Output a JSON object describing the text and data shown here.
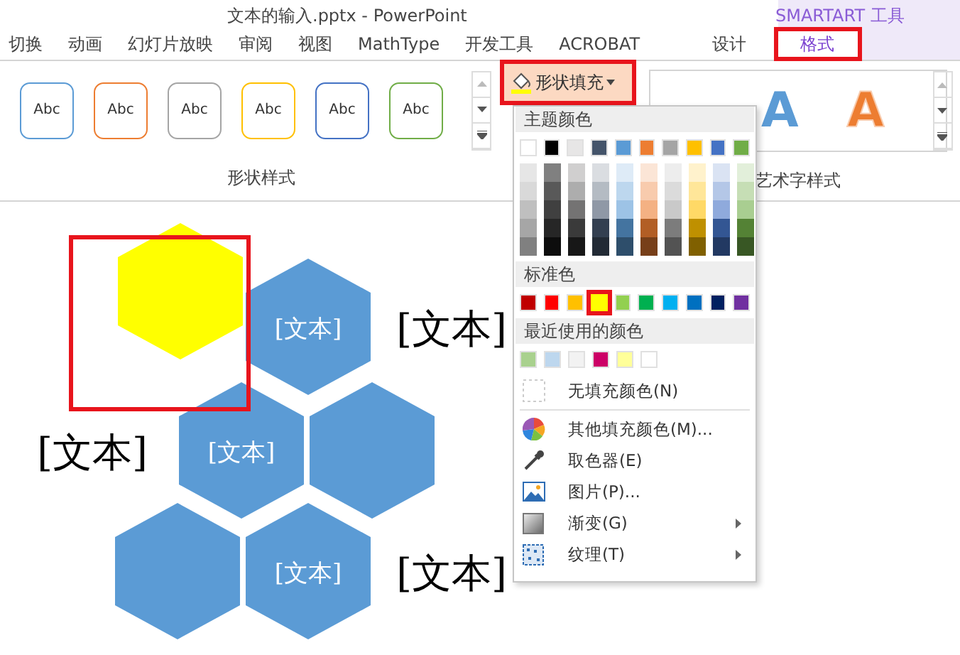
{
  "window": {
    "title": "文本的输入.pptx - PowerPoint",
    "context_label": "SMARTART 工具"
  },
  "tabs": [
    {
      "label": "切换",
      "selected": false,
      "contextual": false
    },
    {
      "label": "动画",
      "selected": false,
      "contextual": false
    },
    {
      "label": "幻灯片放映",
      "selected": false,
      "contextual": false
    },
    {
      "label": "审阅",
      "selected": false,
      "contextual": false
    },
    {
      "label": "视图",
      "selected": false,
      "contextual": false
    },
    {
      "label": "MathType",
      "selected": false,
      "contextual": false
    },
    {
      "label": "开发工具",
      "selected": false,
      "contextual": false
    },
    {
      "label": "ACROBAT",
      "selected": false,
      "contextual": false
    },
    {
      "label": "设计",
      "selected": false,
      "contextual": true
    },
    {
      "label": "格式",
      "selected": true,
      "contextual": true
    }
  ],
  "shape_styles": {
    "label": "形状样式",
    "items": [
      {
        "text": "Abc",
        "color": "#5b9bd5"
      },
      {
        "text": "Abc",
        "color": "#ed7d31"
      },
      {
        "text": "Abc",
        "color": "#a5a5a5"
      },
      {
        "text": "Abc",
        "color": "#ffc000"
      },
      {
        "text": "Abc",
        "color": "#4472c4"
      },
      {
        "text": "Abc",
        "color": "#70ad47"
      }
    ]
  },
  "wordart_styles": {
    "label": "艺术字样式",
    "items": [
      {
        "text": "A",
        "color": "#5b9bd5"
      },
      {
        "text": "A",
        "color": "#ed7d31"
      }
    ]
  },
  "shape_fill_button": {
    "label": "形状填充",
    "open": true
  },
  "fill_menu": {
    "theme_header": "主题颜色",
    "theme_colors": [
      {
        "color": "#ffffff"
      },
      {
        "color": "#000000"
      },
      {
        "color": "#e7e6e6"
      },
      {
        "color": "#44546a"
      },
      {
        "color": "#5b9bd5"
      },
      {
        "color": "#ed7d31"
      },
      {
        "color": "#a5a5a5"
      },
      {
        "color": "#ffc000"
      },
      {
        "color": "#4472c4"
      },
      {
        "color": "#70ad47"
      }
    ],
    "standard_header": "标准色",
    "standard_colors": [
      {
        "color": "#c00000",
        "selected": false
      },
      {
        "color": "#ff0000",
        "selected": false
      },
      {
        "color": "#ffc000",
        "selected": false
      },
      {
        "color": "#ffff00",
        "selected": true
      },
      {
        "color": "#92d050",
        "selected": false
      },
      {
        "color": "#00b050",
        "selected": false
      },
      {
        "color": "#00b0f0",
        "selected": false
      },
      {
        "color": "#0070c0",
        "selected": false
      },
      {
        "color": "#002060",
        "selected": false
      },
      {
        "color": "#7030a0",
        "selected": false
      }
    ],
    "recent_header": "最近使用的颜色",
    "recent_colors": [
      {
        "color": "#a9d18e"
      },
      {
        "color": "#bdd7ee"
      },
      {
        "color": "#f2f2f2"
      },
      {
        "color": "#cc0066"
      },
      {
        "color": "#ffff99"
      },
      {
        "color": "#ffffff"
      }
    ],
    "items": [
      {
        "kind": "none",
        "label": "无填充颜色(N)",
        "has_submenu": false
      },
      {
        "kind": "more",
        "label": "其他填充颜色(M)...",
        "has_submenu": false
      },
      {
        "kind": "eyedropper",
        "label": "取色器(E)",
        "has_submenu": false
      },
      {
        "kind": "picture",
        "label": "图片(P)...",
        "has_submenu": false
      },
      {
        "kind": "gradient",
        "label": "渐变(G)",
        "has_submenu": true
      },
      {
        "kind": "texture",
        "label": "纹理(T)",
        "has_submenu": true
      }
    ]
  },
  "diagram": {
    "hexagons": [
      {
        "color": "#ffff00",
        "selected": true
      },
      {
        "text": "[文本]",
        "color": "#5b9bd5",
        "selected": false
      },
      {
        "text": "[文本]",
        "color": "#5b9bd5",
        "selected": false
      },
      {
        "color": "#5b9bd5",
        "selected": false
      },
      {
        "color": "#5b9bd5",
        "selected": false
      },
      {
        "text": "[文本]",
        "color": "#5b9bd5",
        "selected": false
      }
    ],
    "labels": [
      "[文本]",
      "[文本]",
      "[文本]"
    ]
  }
}
